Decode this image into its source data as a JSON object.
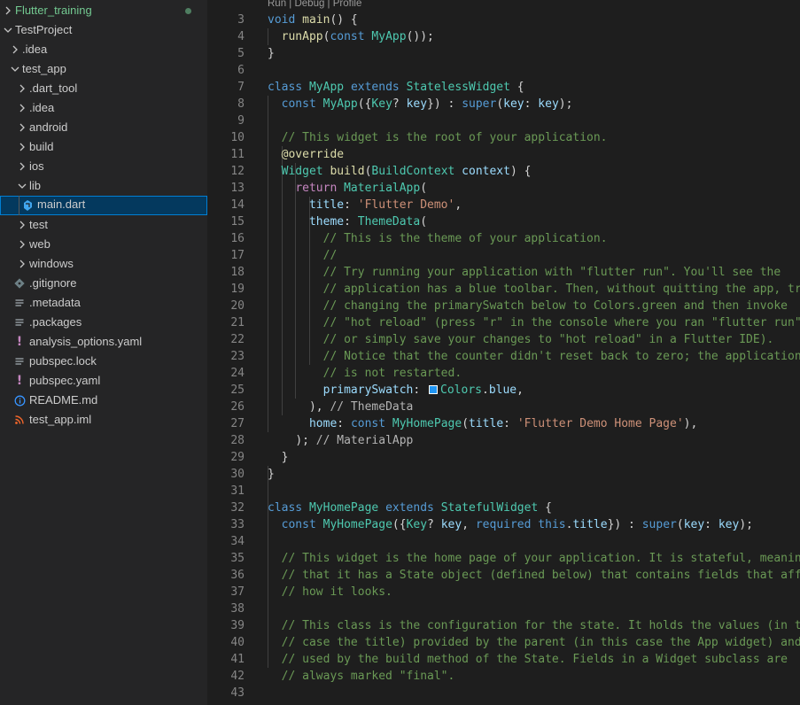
{
  "colors": {
    "sidebar_bg": "#252526",
    "editor_bg": "#1e1e1e",
    "selection_bg": "#04395e",
    "selection_border": "#007fd4",
    "git_modified_green": "#73c991",
    "dart_blue": "#40a6ef",
    "yaml_purple": "#c586c0",
    "info_blue": "#3794ff",
    "xml_orange": "#f1662a",
    "swatch_blue": "#2196f3"
  },
  "explorer": {
    "items": [
      {
        "label": "Flutter_training",
        "icon": "chevron-right-icon",
        "depth": 0,
        "folder": true,
        "expanded": false,
        "modified": true
      },
      {
        "label": "TestProject",
        "icon": "chevron-down-icon",
        "depth": 0,
        "folder": true,
        "expanded": true
      },
      {
        "label": ".idea",
        "icon": "chevron-right-icon",
        "depth": 1,
        "folder": true,
        "expanded": false
      },
      {
        "label": "test_app",
        "icon": "chevron-down-icon",
        "depth": 1,
        "folder": true,
        "expanded": true
      },
      {
        "label": ".dart_tool",
        "icon": "chevron-right-icon",
        "depth": 2,
        "folder": true,
        "expanded": false
      },
      {
        "label": ".idea",
        "icon": "chevron-right-icon",
        "depth": 2,
        "folder": true,
        "expanded": false
      },
      {
        "label": "android",
        "icon": "chevron-right-icon",
        "depth": 2,
        "folder": true,
        "expanded": false
      },
      {
        "label": "build",
        "icon": "chevron-right-icon",
        "depth": 2,
        "folder": true,
        "expanded": false
      },
      {
        "label": "ios",
        "icon": "chevron-right-icon",
        "depth": 2,
        "folder": true,
        "expanded": false
      },
      {
        "label": "lib",
        "icon": "chevron-down-icon",
        "depth": 2,
        "folder": true,
        "expanded": true
      },
      {
        "label": "main.dart",
        "icon": "dart-file-icon",
        "depth": 3,
        "folder": false,
        "selected": true
      },
      {
        "label": "test",
        "icon": "chevron-right-icon",
        "depth": 2,
        "folder": true,
        "expanded": false
      },
      {
        "label": "web",
        "icon": "chevron-right-icon",
        "depth": 2,
        "folder": true,
        "expanded": false
      },
      {
        "label": "windows",
        "icon": "chevron-right-icon",
        "depth": 2,
        "folder": true,
        "expanded": false
      },
      {
        "label": ".gitignore",
        "icon": "git-file-icon",
        "depth": 2,
        "folder": false
      },
      {
        "label": ".metadata",
        "icon": "lines-file-icon",
        "depth": 2,
        "folder": false
      },
      {
        "label": ".packages",
        "icon": "lines-file-icon",
        "depth": 2,
        "folder": false
      },
      {
        "label": "analysis_options.yaml",
        "icon": "yaml-file-icon",
        "depth": 2,
        "folder": false
      },
      {
        "label": "pubspec.lock",
        "icon": "lines-file-icon",
        "depth": 2,
        "folder": false
      },
      {
        "label": "pubspec.yaml",
        "icon": "yaml-file-icon",
        "depth": 2,
        "folder": false
      },
      {
        "label": "README.md",
        "icon": "info-file-icon",
        "depth": 2,
        "folder": false
      },
      {
        "label": "test_app.iml",
        "icon": "rss-file-icon",
        "depth": 2,
        "folder": false
      }
    ]
  },
  "editor": {
    "codelens": "Run | Debug | Profile",
    "line_numbers": [
      "3",
      "4",
      "5",
      "6",
      "7",
      "8",
      "9",
      "10",
      "11",
      "12",
      "13",
      "14",
      "15",
      "16",
      "17",
      "18",
      "19",
      "20",
      "21",
      "22",
      "23",
      "24",
      "25",
      "26",
      "27",
      "28",
      "29",
      "30",
      "31",
      "32",
      "33",
      "34",
      "35",
      "36",
      "37",
      "38",
      "39",
      "40",
      "41",
      "42",
      "43"
    ],
    "lines": [
      [
        [
          "void",
          "#569cd6"
        ],
        [
          " ",
          null
        ],
        [
          "main",
          "#dcdcaa"
        ],
        [
          "() {",
          null
        ]
      ],
      [
        [
          "  ",
          null
        ],
        [
          "runApp",
          "#dcdcaa"
        ],
        [
          "(",
          null
        ],
        [
          "const",
          "#569cd6"
        ],
        [
          " ",
          null
        ],
        [
          "MyApp",
          "#4ec9b0"
        ],
        [
          "());",
          null
        ]
      ],
      [
        [
          "}",
          null
        ]
      ],
      [],
      [
        [
          "class",
          "#569cd6"
        ],
        [
          " ",
          null
        ],
        [
          "MyApp",
          "#4ec9b0"
        ],
        [
          " ",
          null
        ],
        [
          "extends",
          "#569cd6"
        ],
        [
          " ",
          null
        ],
        [
          "StatelessWidget",
          "#4ec9b0"
        ],
        [
          " {",
          null
        ]
      ],
      [
        [
          "  ",
          null
        ],
        [
          "const",
          "#569cd6"
        ],
        [
          " ",
          null
        ],
        [
          "MyApp",
          "#4ec9b0"
        ],
        [
          "({",
          null
        ],
        [
          "Key",
          "#4ec9b0"
        ],
        [
          "? ",
          null
        ],
        [
          "key",
          "#9cdcfe"
        ],
        [
          "}) : ",
          null
        ],
        [
          "super",
          "#569cd6"
        ],
        [
          "(",
          null
        ],
        [
          "key",
          "#9cdcfe"
        ],
        [
          ": ",
          null
        ],
        [
          "key",
          "#9cdcfe"
        ],
        [
          ");",
          null
        ]
      ],
      [],
      [
        [
          "  ",
          null
        ],
        [
          "// This widget is the root of your application.",
          "#6a9955"
        ]
      ],
      [
        [
          "  ",
          null
        ],
        [
          "@override",
          "#dcdcaa"
        ]
      ],
      [
        [
          "  ",
          null
        ],
        [
          "Widget",
          "#4ec9b0"
        ],
        [
          " ",
          null
        ],
        [
          "build",
          "#dcdcaa"
        ],
        [
          "(",
          null
        ],
        [
          "BuildContext",
          "#4ec9b0"
        ],
        [
          " ",
          null
        ],
        [
          "context",
          "#9cdcfe"
        ],
        [
          ") {",
          null
        ]
      ],
      [
        [
          "    ",
          null
        ],
        [
          "return",
          "#c586c0"
        ],
        [
          " ",
          null
        ],
        [
          "MaterialApp",
          "#4ec9b0"
        ],
        [
          "(",
          null
        ]
      ],
      [
        [
          "      ",
          null
        ],
        [
          "title",
          "#9cdcfe"
        ],
        [
          ": ",
          null
        ],
        [
          "'Flutter Demo'",
          "#ce9178"
        ],
        [
          ",",
          null
        ]
      ],
      [
        [
          "      ",
          null
        ],
        [
          "theme",
          "#9cdcfe"
        ],
        [
          ": ",
          null
        ],
        [
          "ThemeData",
          "#4ec9b0"
        ],
        [
          "(",
          null
        ]
      ],
      [
        [
          "        ",
          null
        ],
        [
          "// This is the theme of your application.",
          "#6a9955"
        ]
      ],
      [
        [
          "        ",
          null
        ],
        [
          "//",
          "#6a9955"
        ]
      ],
      [
        [
          "        ",
          null
        ],
        [
          "// Try running your application with \"flutter run\". You'll see the",
          "#6a9955"
        ]
      ],
      [
        [
          "        ",
          null
        ],
        [
          "// application has a blue toolbar. Then, without quitting the app, try",
          "#6a9955"
        ]
      ],
      [
        [
          "        ",
          null
        ],
        [
          "// changing the primarySwatch below to Colors.green and then invoke",
          "#6a9955"
        ]
      ],
      [
        [
          "        ",
          null
        ],
        [
          "// \"hot reload\" (press \"r\" in the console where you ran \"flutter run\",",
          "#6a9955"
        ]
      ],
      [
        [
          "        ",
          null
        ],
        [
          "// or simply save your changes to \"hot reload\" in a Flutter IDE).",
          "#6a9955"
        ]
      ],
      [
        [
          "        ",
          null
        ],
        [
          "// Notice that the counter didn't reset back to zero; the application",
          "#6a9955"
        ]
      ],
      [
        [
          "        ",
          null
        ],
        [
          "// is not restarted.",
          "#6a9955"
        ]
      ],
      [
        [
          "        ",
          null
        ],
        [
          "primarySwatch",
          "#9cdcfe"
        ],
        [
          ": ",
          null
        ],
        [
          "SWATCH",
          "#2196f3"
        ],
        [
          "Colors",
          "#4ec9b0"
        ],
        [
          ".",
          null
        ],
        [
          "blue",
          "#9cdcfe"
        ],
        [
          ",",
          null
        ]
      ],
      [
        [
          "      ",
          null
        ],
        [
          "), ",
          null
        ],
        [
          "// ThemeData",
          "#b4b4b4"
        ]
      ],
      [
        [
          "      ",
          null
        ],
        [
          "home",
          "#9cdcfe"
        ],
        [
          ": ",
          null
        ],
        [
          "const",
          "#569cd6"
        ],
        [
          " ",
          null
        ],
        [
          "MyHomePage",
          "#4ec9b0"
        ],
        [
          "(",
          null
        ],
        [
          "title",
          "#9cdcfe"
        ],
        [
          ": ",
          null
        ],
        [
          "'Flutter Demo Home Page'",
          "#ce9178"
        ],
        [
          "),",
          null
        ]
      ],
      [
        [
          "    ",
          null
        ],
        [
          "); ",
          null
        ],
        [
          "// MaterialApp",
          "#b4b4b4"
        ]
      ],
      [
        [
          "  ",
          null
        ],
        [
          "}",
          null
        ]
      ],
      [
        [
          "}",
          null
        ]
      ],
      [],
      [
        [
          "class",
          "#569cd6"
        ],
        [
          " ",
          null
        ],
        [
          "MyHomePage",
          "#4ec9b0"
        ],
        [
          " ",
          null
        ],
        [
          "extends",
          "#569cd6"
        ],
        [
          " ",
          null
        ],
        [
          "StatefulWidget",
          "#4ec9b0"
        ],
        [
          " {",
          null
        ]
      ],
      [
        [
          "  ",
          null
        ],
        [
          "const",
          "#569cd6"
        ],
        [
          " ",
          null
        ],
        [
          "MyHomePage",
          "#4ec9b0"
        ],
        [
          "({",
          null
        ],
        [
          "Key",
          "#4ec9b0"
        ],
        [
          "? ",
          null
        ],
        [
          "key",
          "#9cdcfe"
        ],
        [
          ", ",
          null
        ],
        [
          "required",
          "#569cd6"
        ],
        [
          " ",
          null
        ],
        [
          "this",
          "#569cd6"
        ],
        [
          ".",
          null
        ],
        [
          "title",
          "#9cdcfe"
        ],
        [
          "}) : ",
          null
        ],
        [
          "super",
          "#569cd6"
        ],
        [
          "(",
          null
        ],
        [
          "key",
          "#9cdcfe"
        ],
        [
          ": ",
          null
        ],
        [
          "key",
          "#9cdcfe"
        ],
        [
          ");",
          null
        ]
      ],
      [],
      [
        [
          "  ",
          null
        ],
        [
          "// This widget is the home page of your application. It is stateful, meaning",
          "#6a9955"
        ]
      ],
      [
        [
          "  ",
          null
        ],
        [
          "// that it has a State object (defined below) that contains fields that affect",
          "#6a9955"
        ]
      ],
      [
        [
          "  ",
          null
        ],
        [
          "// how it looks.",
          "#6a9955"
        ]
      ],
      [],
      [
        [
          "  ",
          null
        ],
        [
          "// This class is the configuration for the state. It holds the values (in this",
          "#6a9955"
        ]
      ],
      [
        [
          "  ",
          null
        ],
        [
          "// case the title) provided by the parent (in this case the App widget) and",
          "#6a9955"
        ]
      ],
      [
        [
          "  ",
          null
        ],
        [
          "// used by the build method of the State. Fields in a Widget subclass are",
          "#6a9955"
        ]
      ],
      [
        [
          "  ",
          null
        ],
        [
          "// always marked \"final\".",
          "#6a9955"
        ]
      ],
      []
    ]
  }
}
